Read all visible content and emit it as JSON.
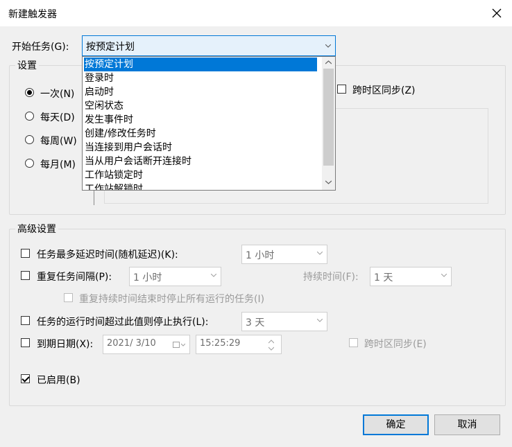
{
  "window": {
    "title": "新建触发器"
  },
  "start_task": {
    "label": "开始任务(G):",
    "selected": "按预定计划",
    "options": [
      "按预定计划",
      "登录时",
      "启动时",
      "空闲状态",
      "发生事件时",
      "创建/修改任务时",
      "当连接到用户会话时",
      "当从用户会话断开连接时",
      "工作站锁定时",
      "工作站解锁时"
    ]
  },
  "settings": {
    "label": "设置",
    "radios": [
      "一次(N)",
      "每天(D)",
      "每周(W)",
      "每月(M)"
    ],
    "sync_tz": "跨时区同步(Z)"
  },
  "advanced": {
    "label": "高级设置",
    "delay": {
      "label": "任务最多延迟时间(随机延迟)(K):",
      "value": "1 小时"
    },
    "repeat": {
      "label": "重复任务间隔(P):",
      "value": "1 小时",
      "duration_label": "持续时间(F):",
      "duration_value": "1 天"
    },
    "stop_all": "重复持续时间结束时停止所有运行的任务(I)",
    "stop_if": {
      "label": "任务的运行时间超过此值则停止执行(L):",
      "value": "3 天"
    },
    "expire": {
      "label": "到期日期(X):",
      "date": "2021/ 3/10",
      "time": "15:25:29",
      "sync_tz": "跨时区同步(E)"
    },
    "enabled": "已启用(B)"
  },
  "buttons": {
    "ok": "确定",
    "cancel": "取消"
  },
  "colors": {
    "accent": "#0078d7",
    "disabled_text": "#9a9a9a"
  }
}
